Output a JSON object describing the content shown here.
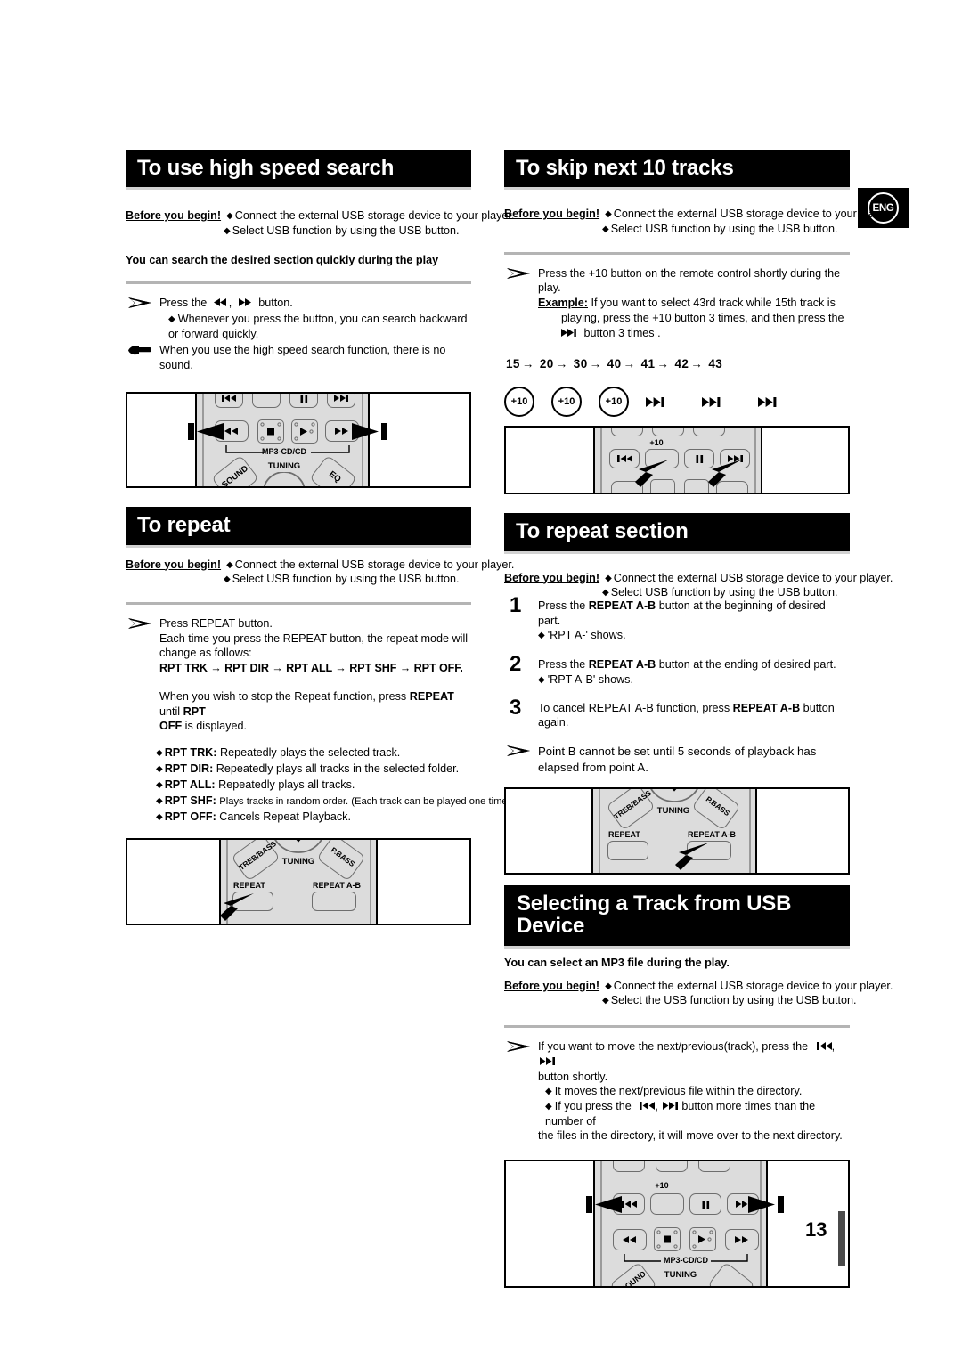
{
  "page": {
    "number": "13",
    "language_badge": "ENG"
  },
  "common": {
    "before_you_begin_label": "Before you begin!",
    "byb_connect": "Connect the external USB storage device to your player.",
    "byb_select_usb": "Select USB function by using the USB button.",
    "byb_select_the_usb": "Select the USB function by using the USB button."
  },
  "sections": {
    "high_speed_search": {
      "title": "To use high speed search",
      "intro_bold": "You can search the desired section quickly during the play",
      "step_prefix": "Press the",
      "step_suffix": "button.",
      "bullet1": "Whenever you press the button, you can search backward or forward quickly.",
      "note": "When you use the high speed search function, there is no sound."
    },
    "skip_10": {
      "title": "To skip next 10 tracks",
      "step": "Press the +10 button on the remote control shortly during the play.",
      "step_bold_token": "+10",
      "example_label": "Example:",
      "example_line1": "If you want to select 43rd track while 15th track is",
      "example_line2": "playing, press the +10 button 3 times, and then press the",
      "example_line3": "button 3 times .",
      "sequence": [
        "15",
        "20",
        "30",
        "40",
        "41",
        "42",
        "43"
      ],
      "buttons": [
        "+10",
        "+10",
        "+10",
        "next",
        "next",
        "next"
      ]
    },
    "to_repeat": {
      "title": "To repeat",
      "step": "Press REPEAT button.",
      "line2": "Each time you press the REPEAT button, the repeat mode will",
      "line3": "change as follows:",
      "mode_chain": "RPT TRK → RPT DIR → RPT ALL → RPT SHF → RPT OFF.",
      "stop_line1_a": "When you wish to stop the Repeat function, press ",
      "stop_line1_b": "REPEAT",
      "stop_line1_c": " until ",
      "stop_line1_d": "RPT",
      "stop_line2_a": "OFF",
      "stop_line2_b": " is displayed.",
      "modes": [
        {
          "name": "RPT TRK:",
          "desc": "Repeatedly plays the selected track.",
          "small": false
        },
        {
          "name": "RPT DIR:",
          "desc": "Repeatedly plays all tracks in the selected folder.",
          "small": false
        },
        {
          "name": "RPT ALL:",
          "desc": "Repeatedly plays all tracks.",
          "small": false
        },
        {
          "name": "RPT SHF:",
          "desc": "Plays tracks in random order. (Each track can be played one time.)",
          "small": true
        },
        {
          "name": "RPT OFF:",
          "desc": "Cancels Repeat Playback.",
          "small": false
        }
      ]
    },
    "repeat_section": {
      "title": "To repeat section",
      "steps": [
        {
          "num": "1",
          "text_a": "Press the ",
          "bold": "REPEAT A-B",
          "text_b": " button at the beginning of desired part.",
          "bullet": "'RPT A-' shows."
        },
        {
          "num": "2",
          "text_a": "Press the ",
          "bold": "REPEAT A-B",
          "text_b": " button at the ending of desired part.",
          "bullet": "'RPT A-B' shows."
        },
        {
          "num": "3",
          "text_a": "To cancel REPEAT A-B function, press ",
          "bold": "REPEAT A-B",
          "text_b": " button again.",
          "bullet": ""
        }
      ],
      "note_line1": "Point B cannot be set until 5 seconds of playback has",
      "note_line2": "elapsed from point A."
    },
    "select_track_usb": {
      "title": "Selecting a Track from USB Device",
      "intro_bold": "You can select an MP3 file during the play.",
      "step_line1_a": "If you want to move the next/previous(track), press the",
      "step_line2": "button shortly.",
      "bullet1": "It moves the next/previous file within the directory.",
      "bullet2_a": "If you press the",
      "bullet2_b": "button more times than the number of",
      "bullet2_c": "the files in the directory, it will move over to the next directory."
    }
  },
  "remote_labels": {
    "mp3_cd_cd": "MP3-CD/CD",
    "tuning": "TUNING",
    "sound": "SOUND",
    "eq": "EQ",
    "treb_bass": "TREB/BASS",
    "p_bass": "P.BASS",
    "repeat": "REPEAT",
    "repeat_ab": "REPEAT A-B",
    "plus10": "+10"
  }
}
